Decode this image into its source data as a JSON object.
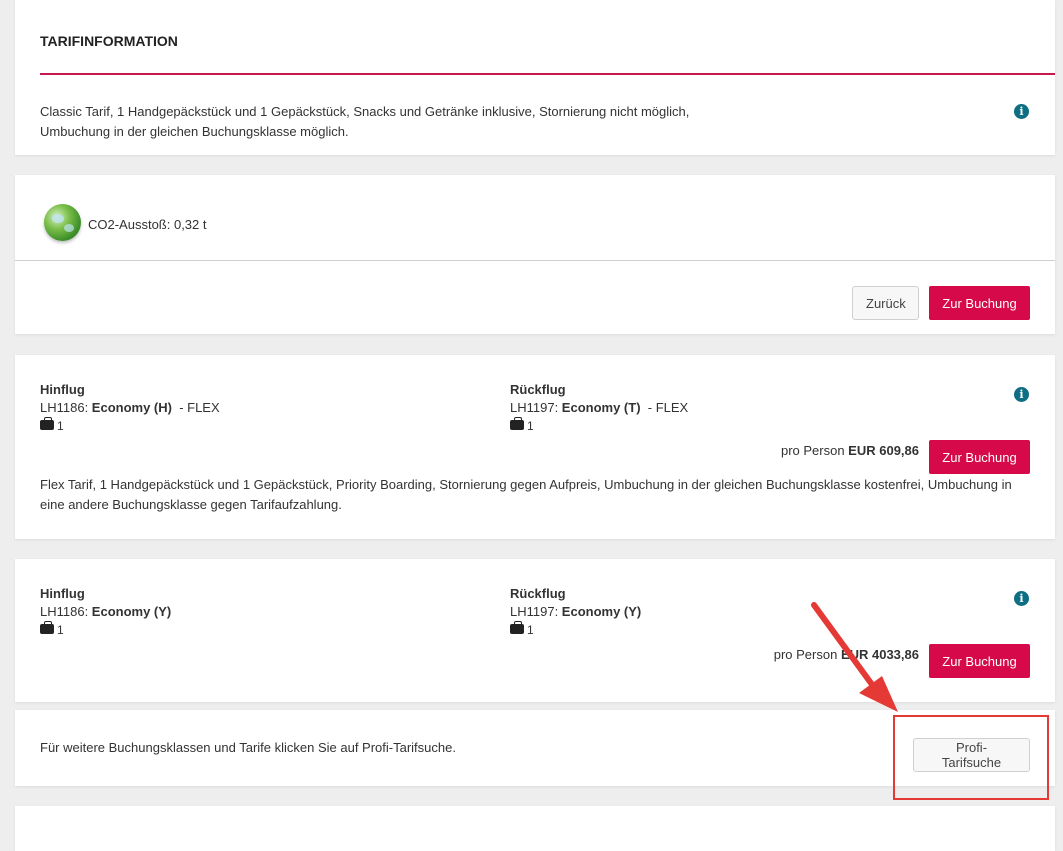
{
  "tariff_info": {
    "title": "TARIFINFORMATION",
    "text_line1": "Classic Tarif, 1 Handgepäckstück und 1 Gepäckstück, Snacks und Getränke inklusive, Stornierung nicht möglich,",
    "text_line2": "Umbuchung in der gleichen Buchungsklasse möglich."
  },
  "co2": {
    "label": "CO2-Ausstoß: 0,32 t"
  },
  "actions": {
    "back_label": "Zurück",
    "book_label": "Zur Buchung"
  },
  "offers": [
    {
      "outbound_heading": "Hinflug",
      "outbound_flight": "LH1186: ",
      "outbound_class": "Economy (H)",
      "outbound_fare": "  - FLEX",
      "outbound_bags": "1",
      "return_heading": "Rückflug",
      "return_flight": "LH1197: ",
      "return_class": "Economy (T)",
      "return_fare": "  - FLEX",
      "return_bags": "1",
      "price_prefix": "pro Person ",
      "price": "EUR 609,86",
      "book_label": "Zur Buchung",
      "description_line1": "Flex Tarif, 1 Handgepäckstück und 1 Gepäckstück, Priority Boarding, Stornierung gegen Aufpreis, Umbuchung in der gleichen Buchungsklasse kostenfrei, Umbuchung in",
      "description_line2": "eine andere Buchungsklasse gegen Tarifaufzahlung."
    },
    {
      "outbound_heading": "Hinflug",
      "outbound_flight": "LH1186: ",
      "outbound_class": "Economy (Y)",
      "outbound_bags": "1",
      "return_heading": "Rückflug",
      "return_flight": "LH1197: ",
      "return_class": "Economy (Y)",
      "return_bags": "1",
      "price_prefix": "pro Person ",
      "price": "EUR 4033,86",
      "book_label": "Zur Buchung"
    }
  ],
  "profi": {
    "text": "Für weitere Buchungsklassen und Tarife klicken Sie auf Profi-Tarifsuche.",
    "button_label": "Profi-Tarifsuche"
  },
  "colors": {
    "accent": "#d6094a",
    "info_icon": "#0e6e84",
    "annotation": "#e53935"
  }
}
